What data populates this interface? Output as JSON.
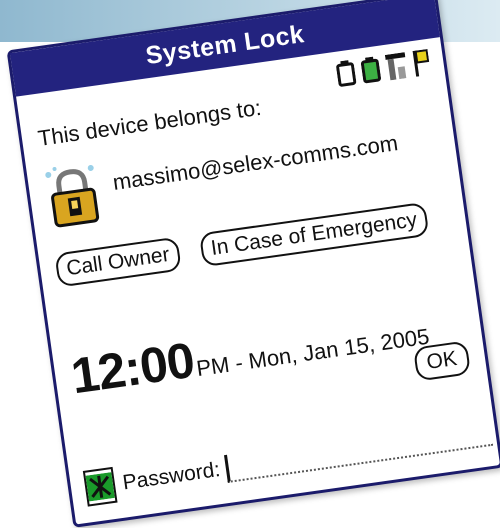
{
  "window": {
    "title": "System Lock"
  },
  "status_icons": [
    "battery-icon",
    "battery-charged-icon",
    "signal-icon",
    "flag-icon"
  ],
  "owner": {
    "belongs_label": "This device belongs to:",
    "email": "massimo@selex-comms.com"
  },
  "buttons": {
    "call_owner": "Call Owner",
    "emergency": "In Case of Emergency",
    "ok": "OK"
  },
  "clock": {
    "time": "12:00",
    "rest": "PM - Mon, Jan 15, 2005"
  },
  "password": {
    "label": "Password:",
    "value": ""
  },
  "colors": {
    "titlebar": "#23237f",
    "check_green": "#1a9a2a",
    "lock_gold": "#d9a520",
    "flag_yellow": "#e8d21a"
  }
}
